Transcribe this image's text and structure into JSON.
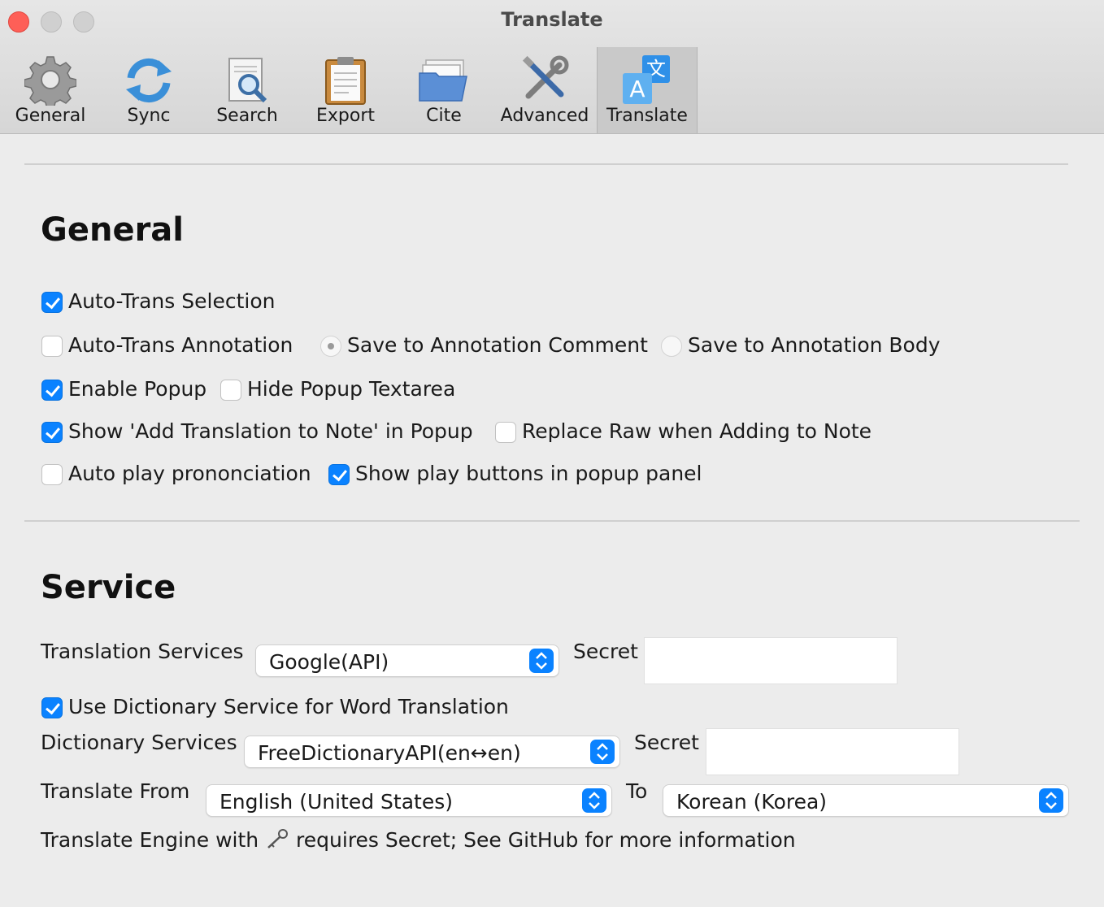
{
  "window": {
    "title": "Translate"
  },
  "tabs": [
    {
      "label": "General",
      "icon": "gear-icon"
    },
    {
      "label": "Sync",
      "icon": "sync-icon"
    },
    {
      "label": "Search",
      "icon": "search-icon"
    },
    {
      "label": "Export",
      "icon": "clipboard-icon"
    },
    {
      "label": "Cite",
      "icon": "folder-icon"
    },
    {
      "label": "Advanced",
      "icon": "tools-icon"
    },
    {
      "label": "Translate",
      "icon": "translate-icon",
      "active": true
    }
  ],
  "general": {
    "heading": "General",
    "auto_trans_selection": {
      "label": "Auto-Trans Selection",
      "checked": true
    },
    "auto_trans_annotation": {
      "label": "Auto-Trans Annotation",
      "checked": false
    },
    "save_to_comment": {
      "label": "Save to Annotation Comment",
      "selected": true
    },
    "save_to_body": {
      "label": "Save to Annotation Body",
      "selected": false
    },
    "enable_popup": {
      "label": "Enable Popup",
      "checked": true
    },
    "hide_popup_textarea": {
      "label": "Hide Popup Textarea",
      "checked": false
    },
    "show_add_translation": {
      "label": "Show 'Add Translation to Note' in Popup",
      "checked": true
    },
    "replace_raw": {
      "label": "Replace Raw when Adding to Note",
      "checked": false
    },
    "auto_play": {
      "label": "Auto play prononciation",
      "checked": false
    },
    "show_play_buttons": {
      "label": "Show play buttons in popup panel",
      "checked": true
    }
  },
  "service": {
    "heading": "Service",
    "translation_services_label": "Translation Services",
    "translation_service_value": "Google(API)",
    "secret_label": "Secret",
    "secret_value": "",
    "use_dictionary": {
      "label": "Use Dictionary Service for Word Translation",
      "checked": true
    },
    "dictionary_services_label": "Dictionary Services",
    "dictionary_service_value": "FreeDictionaryAPI(en↔en)",
    "dict_secret_label": "Secret",
    "dict_secret_value": "",
    "translate_from_label": "Translate From",
    "translate_from_value": "English (United States)",
    "to_label": "To",
    "translate_to_value": "Korean (Korea)",
    "footnote_before": "Translate Engine with",
    "footnote_after": "requires Secret; See GitHub for more information"
  },
  "colors": {
    "accent": "#0a82ff",
    "close": "#fe5f57",
    "background": "#ececec"
  }
}
